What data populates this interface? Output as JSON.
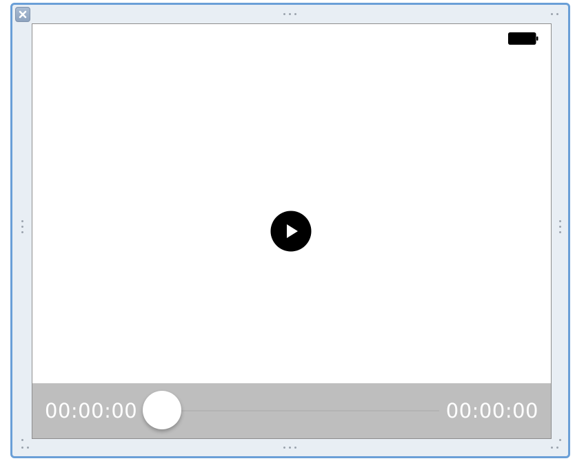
{
  "window": {
    "close_icon": "close-icon",
    "accent_color": "#6a9fd7"
  },
  "player": {
    "status_icon": "battery-icon",
    "play_icon": "play-icon",
    "current_time": "00:00:00",
    "total_time": "00:00:00",
    "progress": 0
  }
}
